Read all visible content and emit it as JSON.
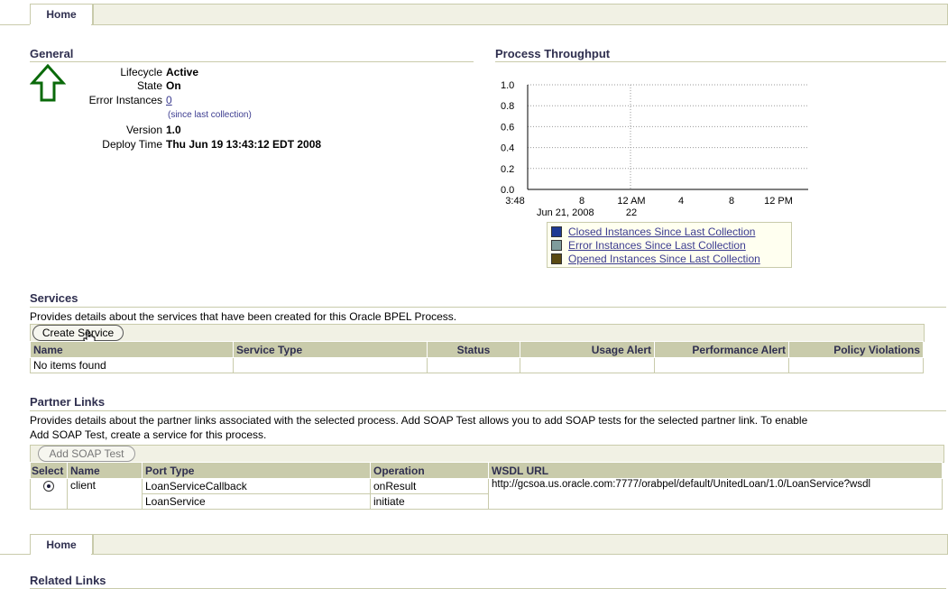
{
  "tabs": {
    "home_label": "Home"
  },
  "general": {
    "title": "General",
    "lifecycle_label": "Lifecycle",
    "lifecycle_value": "Active",
    "state_label": "State",
    "state_value": "On",
    "error_instances_label": "Error Instances",
    "error_instances_value": "0",
    "error_instances_note": "(since last collection)",
    "version_label": "Version",
    "version_value": "1.0",
    "deploy_time_label": "Deploy Time",
    "deploy_time_value": "Thu Jun 19 13:43:12 EDT 2008",
    "status_icon": "up-arrow-icon"
  },
  "throughput": {
    "title": "Process Throughput"
  },
  "chart_data": {
    "type": "line",
    "title": "Process Throughput",
    "y_ticks": [
      "1.0",
      "0.8",
      "0.6",
      "0.4",
      "0.2",
      "0.0"
    ],
    "ylim": [
      0,
      1.0
    ],
    "x_ticks": [
      "3:48",
      "8",
      "12 AM",
      "4",
      "8",
      "12 PM"
    ],
    "x_sublabels": [
      "Jun 21, 2008",
      "22"
    ],
    "grid": true,
    "series": [
      {
        "name": "Closed Instances Since Last Collection",
        "color": "#1f3a93",
        "values": []
      },
      {
        "name": "Error Instances Since Last Collection",
        "color": "#7f9c9c",
        "values": []
      },
      {
        "name": "Opened Instances Since Last Collection",
        "color": "#5a4a12",
        "values": []
      }
    ]
  },
  "services": {
    "title": "Services",
    "description": "Provides details about the services that have been created for this Oracle BPEL Process.",
    "create_button": "Create Service",
    "columns": [
      "Name",
      "Service Type",
      "Status",
      "Usage Alert",
      "Performance Alert",
      "Policy Violations"
    ],
    "empty_text": "No items found"
  },
  "partner_links": {
    "title": "Partner Links",
    "description_line1": "Provides details about the partner links associated with the selected process. Add SOAP Test allows you to add SOAP tests for the selected partner link. To enable",
    "description_line2": "Add SOAP Test, create a service for this process.",
    "add_button": "Add SOAP Test",
    "columns": [
      "Select",
      "Name",
      "Port Type",
      "Operation",
      "WSDL URL"
    ],
    "row": {
      "name": "client",
      "port_type_1": "LoanServiceCallback",
      "operation_1": "onResult",
      "port_type_2": "LoanService",
      "operation_2": "initiate",
      "wsdl_url": "http://gcsoa.us.oracle.com:7777/orabpel/default/UnitedLoan/1.0/LoanService?wsdl"
    }
  },
  "related": {
    "title": "Related Links"
  }
}
